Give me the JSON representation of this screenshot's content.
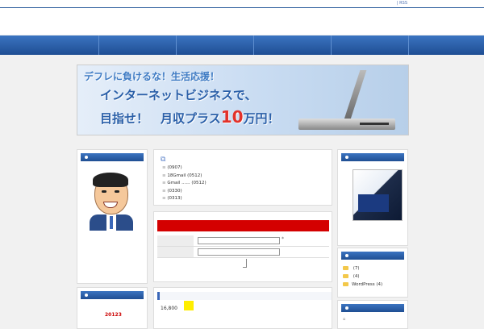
{
  "topbar": {
    "rss_label": "RSS"
  },
  "banner": {
    "line1": "デフレに負けるな！生活応援！",
    "line2": "インターネットビジネスで、",
    "line3_pre": "目指せ！　月収プラス",
    "line3_big": "10",
    "line3_post": "万円！"
  },
  "news": {
    "icon": "document-icon",
    "items": [
      "(0907)",
      "18Gmail  (0512)",
      "Gmail ......  (0512)",
      "(0330)",
      "(0313)"
    ]
  },
  "form": {
    "required_mark": "*",
    "colors": {
      "bar": "#d40000"
    }
  },
  "section": {
    "price": "16,800"
  },
  "categories": {
    "items": [
      {
        "label": "",
        "count": "(7)"
      },
      {
        "label": "",
        "count": "(4)"
      },
      {
        "label": "WordPress",
        "count": "(4)"
      }
    ]
  },
  "left_widget2": {
    "text": "20123"
  },
  "colors": {
    "nav": "#2a5fa8",
    "accent_red": "#e2312a"
  }
}
